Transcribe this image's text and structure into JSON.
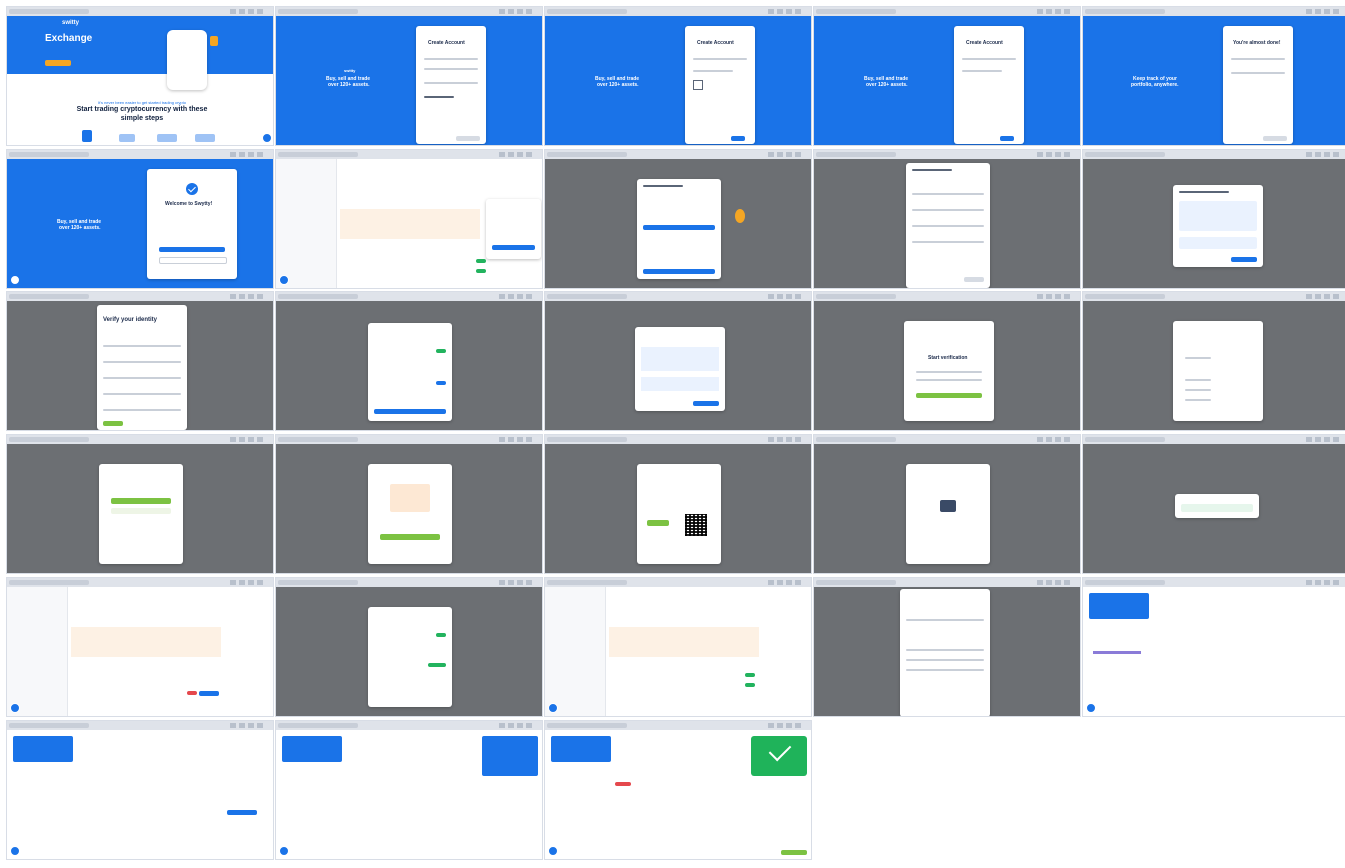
{
  "landing": {
    "brand": "switty",
    "hero_title": "Exchange",
    "steps_kicker": "It's never been easier to get started trading crypto",
    "steps_title_line1": "Start trading cryptocurrency with these",
    "steps_title_line2": "simple steps"
  },
  "signup": {
    "brand": "switty",
    "hero_title_line1": "Buy, sell and trade",
    "hero_title_line2": "over 120+ assets.",
    "keep_track_line1": "Keep track of your",
    "keep_track_line2": "portfolio, anywhere.",
    "create_account": "Create Account",
    "almost_done": "You're almost done!",
    "welcome": "Welcome to Swytty!"
  },
  "kyc": {
    "verify_identity": "Verify your identity",
    "start_verification": "Start verification"
  },
  "colors": {
    "brand_blue": "#1a73e8",
    "overlay_grey": "#6c6f73",
    "success_green": "#1fb35a",
    "action_green": "#7cc242"
  }
}
